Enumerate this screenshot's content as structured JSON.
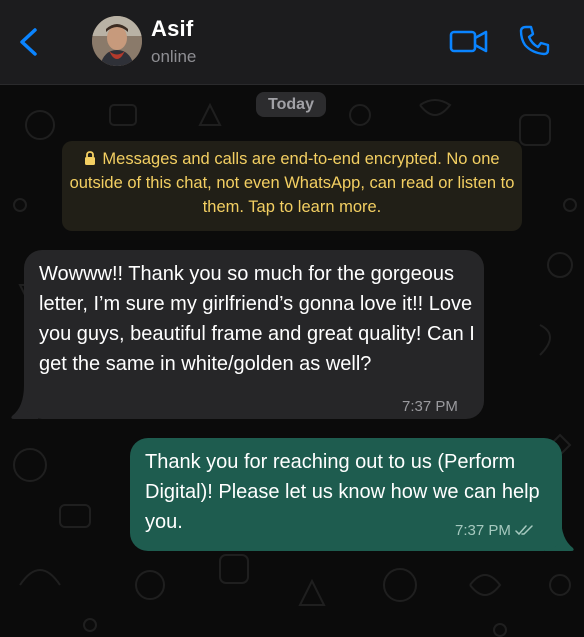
{
  "header": {
    "contact_name": "Asif",
    "status": "online",
    "back_icon": "chevron-left-icon",
    "video_icon": "video-camera-icon",
    "call_icon": "phone-icon",
    "accent_color": "#0a84ff"
  },
  "chat": {
    "date_separator": "Today",
    "encryption_notice": "Messages and calls are end-to-end encrypted. No one outside of this chat, not even WhatsApp, can read or listen to them. Tap to learn more.",
    "messages": [
      {
        "direction": "incoming",
        "text": "Wowww!! Thank you so much for the gorgeous letter, I’m sure my girlfriend’s gonna love it!! Love you guys, beautiful frame and great quality! Can I get the same in white/golden as well?",
        "time": "7:37 PM",
        "bubble_color": "#262628"
      },
      {
        "direction": "outgoing",
        "text": "Thank you for reaching out to us (Perform Digital)! Please let us know how we can help you.",
        "time": "7:37 PM",
        "status_icon": "double-check-icon",
        "bubble_color": "#1e5c4f"
      }
    ]
  }
}
